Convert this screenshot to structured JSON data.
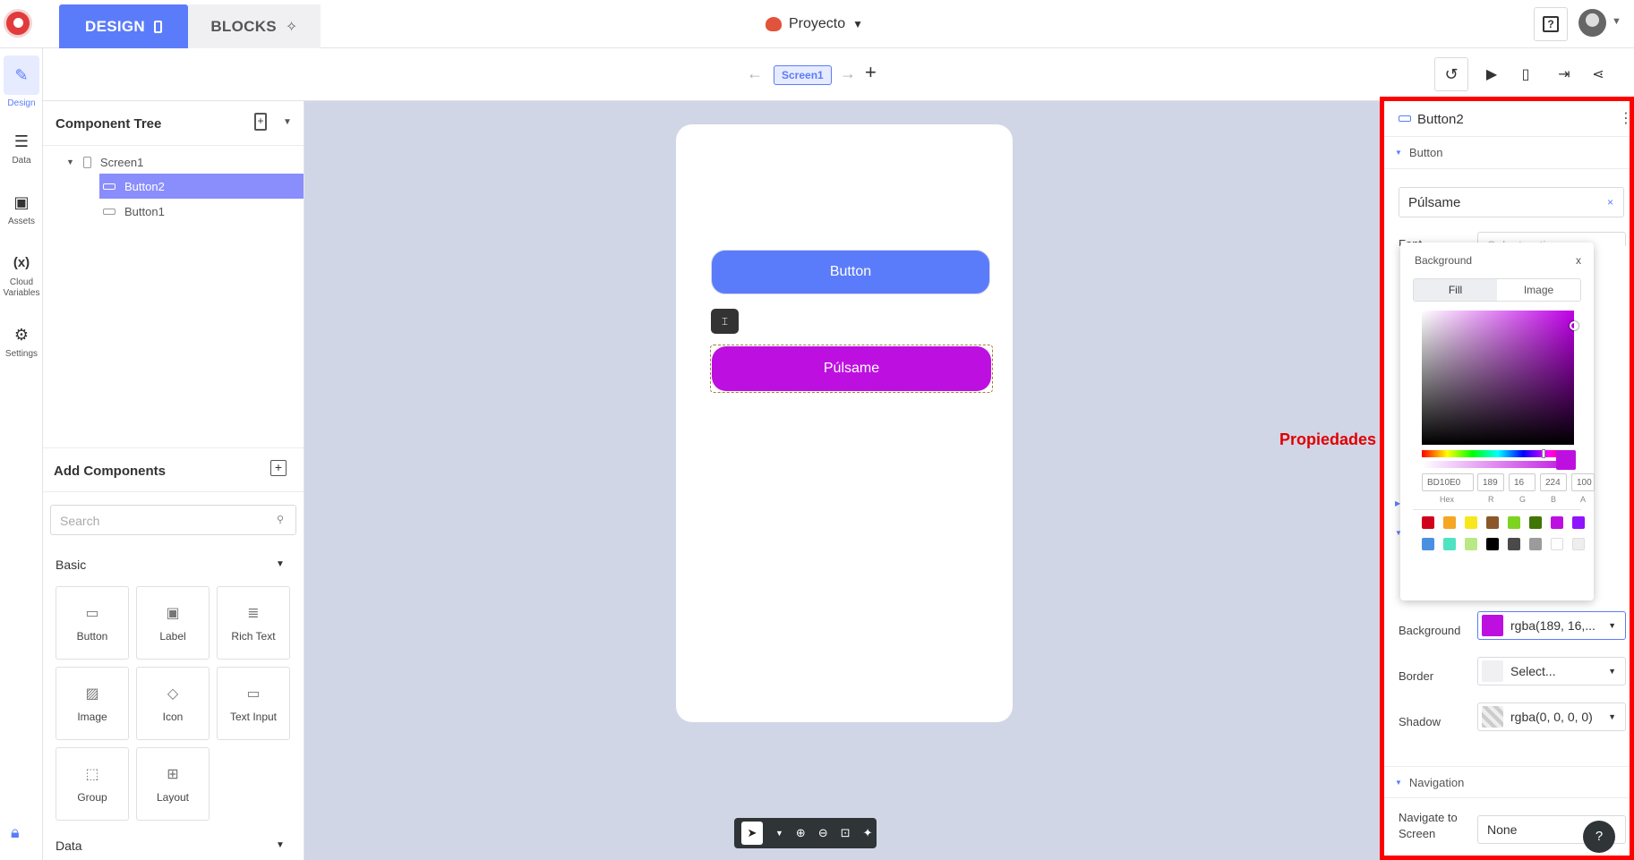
{
  "header": {
    "design_tab": "DESIGN",
    "blocks_tab": "BLOCKS",
    "project_name": "Proyecto"
  },
  "leftnav": [
    {
      "label": "Design",
      "icon": "brush-icon"
    },
    {
      "label": "Data",
      "icon": "database-icon"
    },
    {
      "label": "Assets",
      "icon": "assets-icon"
    },
    {
      "label": "Cloud Variables",
      "icon": "variable-icon",
      "glyph": "(x)"
    },
    {
      "label": "Settings",
      "icon": "gear-icon"
    }
  ],
  "screen_tab": "Screen1",
  "component_tree": {
    "title": "Component Tree",
    "items": [
      "Screen1",
      "Button2",
      "Button1"
    ]
  },
  "add_components": {
    "title": "Add Components",
    "search_placeholder": "Search",
    "basic_label": "Basic",
    "data_label": "Data",
    "items": [
      "Button",
      "Label",
      "Rich Text",
      "Image",
      "Icon",
      "Text Input",
      "Group",
      "Layout"
    ]
  },
  "canvas": {
    "button1_text": "Button",
    "button2_text": "Púlsame",
    "colors": {
      "button1": "#5b7cfa",
      "button2": "#bd10e0"
    }
  },
  "annotation": "Propiedades",
  "properties": {
    "component_name": "Button2",
    "section_button": "Button",
    "text_value": "Púlsame",
    "font_label": "Font",
    "font_placeholder": "Select option",
    "background_label": "Background",
    "background_value": "rgba(189, 16,...",
    "border_label": "Border",
    "border_value": "Select...",
    "shadow_label": "Shadow",
    "shadow_value": "rgba(0, 0, 0, 0)",
    "section_navigation": "Navigation",
    "navigate_label": "Navigate to Screen",
    "navigate_value": "None"
  },
  "color_picker": {
    "title": "Background",
    "close": "x",
    "tab_fill": "Fill",
    "tab_image": "Image",
    "hex": "BD10E0",
    "r": "189",
    "g": "16",
    "b": "224",
    "a": "100",
    "hex_label": "Hex",
    "r_label": "R",
    "g_label": "G",
    "b_label": "B",
    "a_label": "A",
    "presets": [
      "#d0021b",
      "#f5a623",
      "#f8e71c",
      "#8b572a",
      "#7ed321",
      "#417505",
      "#bd10e0",
      "#9013fe",
      "#4a90e2",
      "#50e3c2",
      "#b8e986",
      "#000000",
      "#4a4a4a",
      "#9b9b9b",
      "#ffffff",
      "#eeeeee"
    ]
  }
}
